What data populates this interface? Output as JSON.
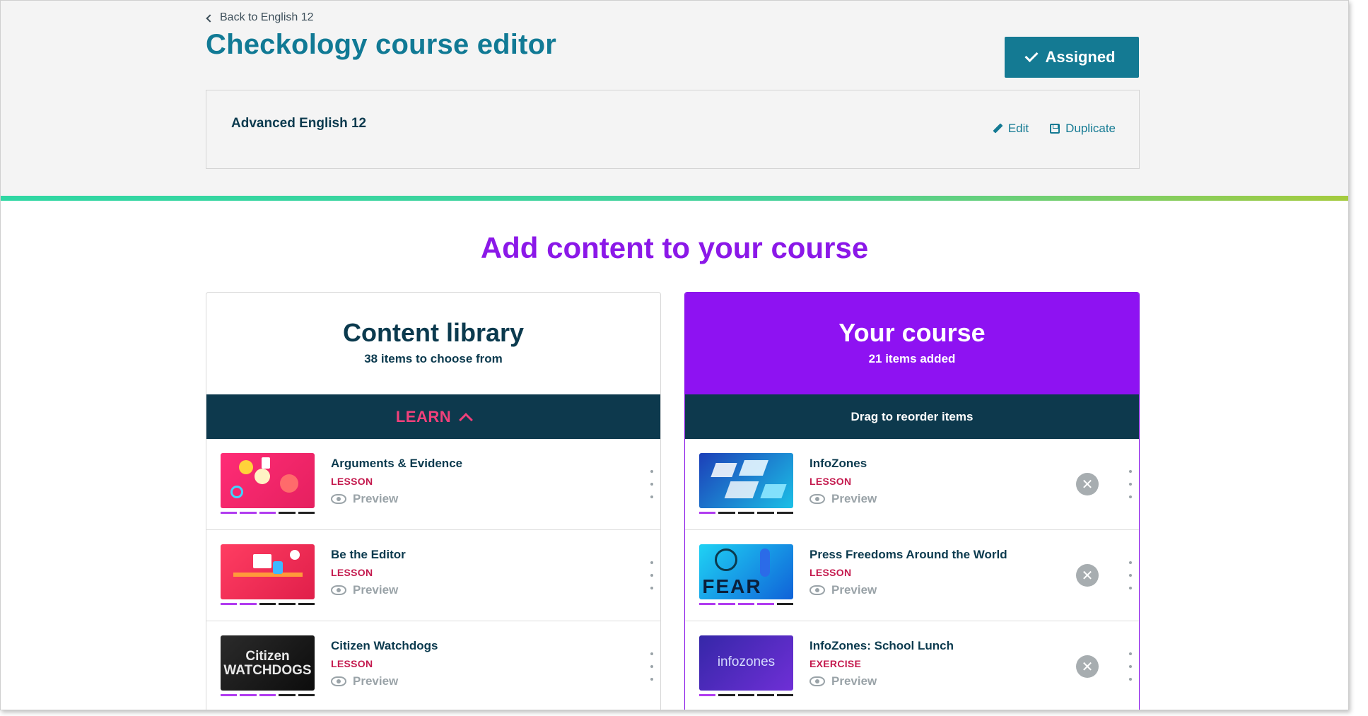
{
  "header": {
    "back_label": "Back to English 12",
    "title": "Checkology course editor",
    "assigned_label": "Assigned"
  },
  "course": {
    "name": "Advanced English 12",
    "edit_label": "Edit",
    "duplicate_label": "Duplicate"
  },
  "section_title": "Add content to your course",
  "library": {
    "title": "Content library",
    "subtitle": "38 items to choose from",
    "bar_label": "LEARN",
    "items": [
      {
        "title": "Arguments & Evidence",
        "type": "LESSON",
        "preview": "Preview",
        "progress": 3
      },
      {
        "title": "Be the Editor",
        "type": "LESSON",
        "preview": "Preview",
        "progress": 2
      },
      {
        "title": "Citizen Watchdogs",
        "type": "LESSON",
        "preview": "Preview",
        "progress": 3,
        "thumb_text": "Citizen WATCHDOGS"
      }
    ]
  },
  "course_panel": {
    "title": "Your course",
    "subtitle": "21 items added",
    "bar_label": "Drag to reorder items",
    "items": [
      {
        "title": "InfoZones",
        "type": "LESSON",
        "preview": "Preview",
        "progress": 1
      },
      {
        "title": "Press Freedoms Around the World",
        "type": "LESSON",
        "preview": "Preview",
        "progress": 4,
        "thumb_text": "FEAR"
      },
      {
        "title": "InfoZones: School Lunch",
        "type": "EXERCISE",
        "preview": "Preview",
        "progress": 1,
        "thumb_text": "infozones"
      }
    ]
  },
  "colors": {
    "title_teal": "#117a95",
    "assigned_bg": "#147a93",
    "heading_purple": "#8b18e8",
    "course_panel_bg": "#8e12f2",
    "dark_bar": "#0d394d",
    "learn_pink": "#f0407a",
    "type_red": "#c41a4e"
  }
}
